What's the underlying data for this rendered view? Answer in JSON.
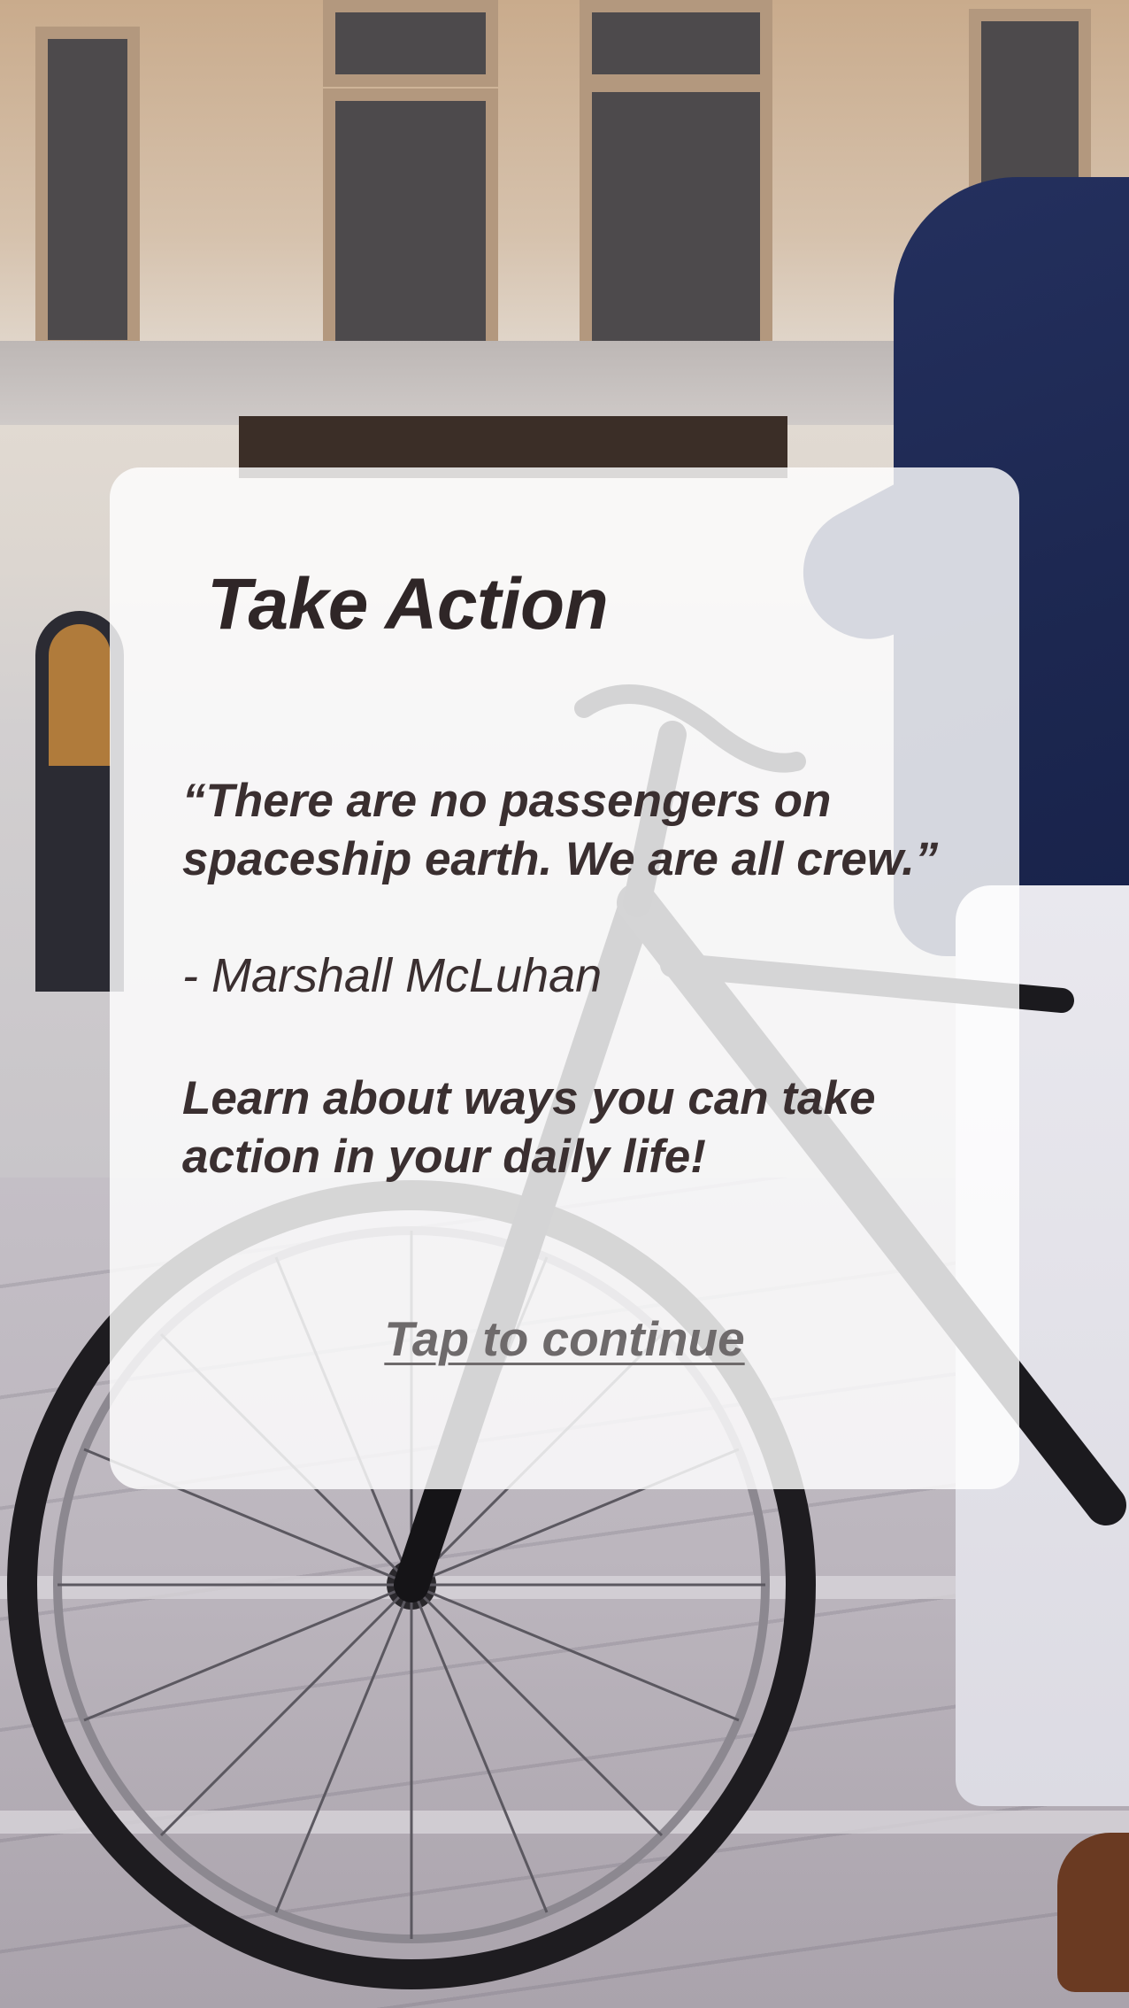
{
  "screen": {
    "title": "Take Action",
    "quote": "“There are no passengers on spaceship earth. We are all crew.”",
    "author": "- Marshall McLuhan",
    "message": "Learn about ways you can take action in your daily life!",
    "continue_label": "Tap to continue",
    "background_image": "person-with-bicycle-on-city-street"
  },
  "colors": {
    "card": "#ffffff",
    "text": "#3a2f30",
    "link": "#6e6a6b",
    "accent_shirt": "#1f2a55"
  }
}
